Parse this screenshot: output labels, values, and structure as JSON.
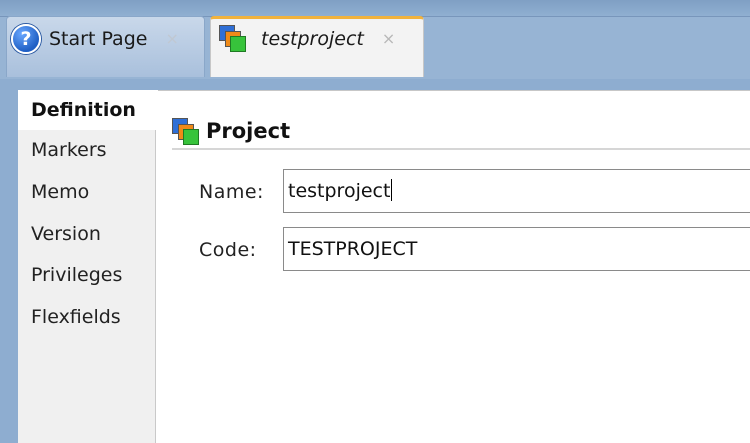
{
  "tabs": [
    {
      "label": "Start Page",
      "icon": "help-icon",
      "close": "×"
    },
    {
      "label": "testproject",
      "icon": "project-icon",
      "close": "×",
      "active": true
    }
  ],
  "nav": {
    "items": [
      {
        "label": "Definition",
        "active": true
      },
      {
        "label": "Markers"
      },
      {
        "label": "Memo"
      },
      {
        "label": "Version"
      },
      {
        "label": "Privileges"
      },
      {
        "label": "Flexfields"
      }
    ]
  },
  "section": {
    "title": "Project",
    "icon": "project-icon"
  },
  "form": {
    "name_label": "Name:",
    "name_value": "testproject",
    "code_label": "Code:",
    "code_value": "TESTPROJECT"
  },
  "colors": {
    "active_tab_accent": "#f2b33d",
    "frame_blue": "#97b4d4"
  }
}
